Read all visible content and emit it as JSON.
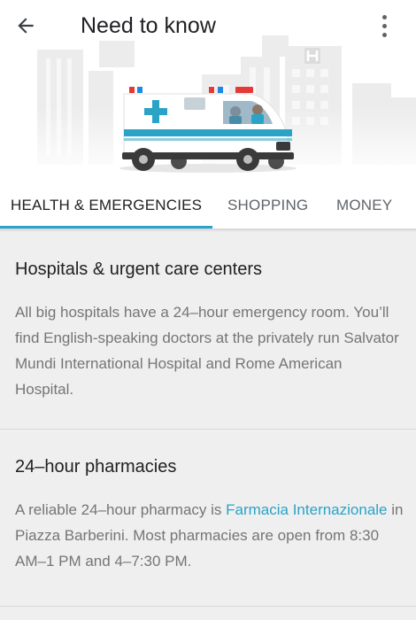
{
  "header": {
    "title": "Need to know",
    "back_icon": "arrow-back-icon",
    "more_icon": "more-vert-icon",
    "illustration": "ambulance-hospital-illustration"
  },
  "tabs": [
    {
      "label": "HEALTH & EMERGENCIES",
      "active": true
    },
    {
      "label": "SHOPPING",
      "active": false
    },
    {
      "label": "MONEY",
      "active": false
    }
  ],
  "colors": {
    "accent": "#2aa3c7",
    "background": "#efefef",
    "header_bg": "#ffffff"
  },
  "sections": [
    {
      "title": "Hospitals & urgent care centers",
      "body": "All big hospitals have a 24–hour emergency room. You’ll find English-speaking doctors at the privately run Salvator Mundi International Hospital and Rome American Hospital."
    },
    {
      "title": "24–hour pharmacies",
      "body_prefix": "A reliable 24–hour pharmacy is ",
      "link_text": "Farmacia Internazionale",
      "body_suffix": " in Piazza Barberini. Most pharmacies are open from 8:30 AM–1 PM and 4–7:30 PM."
    }
  ]
}
